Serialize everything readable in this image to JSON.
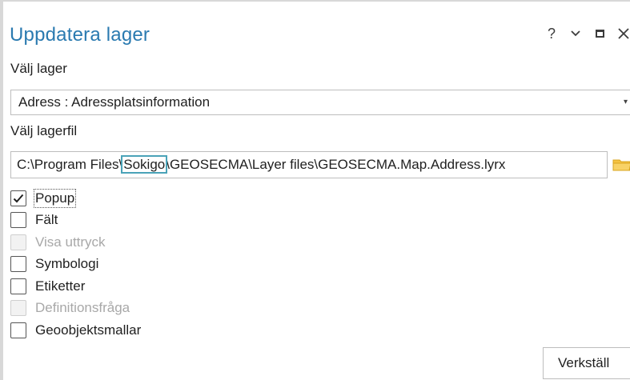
{
  "pane": {
    "title": "Uppdatera lager",
    "controls": {
      "help": "?",
      "menu": "⌄",
      "close": "✕"
    }
  },
  "layer_select": {
    "label": "Välj lager",
    "value": "Adress : Adressplatsinformation",
    "arrow": "▾"
  },
  "layer_file": {
    "label": "Välj lagerfil",
    "path_before": "C:\\Program Files\\",
    "path_highlight": "Sokigo",
    "path_after": "\\GEOSECMA\\Layer files\\GEOSECMA.Map.Address.lyrx"
  },
  "options": [
    {
      "label": "Popup",
      "checked": true,
      "enabled": true
    },
    {
      "label": "Fält",
      "checked": false,
      "enabled": true
    },
    {
      "label": "Visa uttryck",
      "checked": false,
      "enabled": false
    },
    {
      "label": "Symbologi",
      "checked": false,
      "enabled": true
    },
    {
      "label": "Etiketter",
      "checked": false,
      "enabled": true
    },
    {
      "label": "Definitionsfråga",
      "checked": false,
      "enabled": false
    },
    {
      "label": "Geoobjektsmallar",
      "checked": false,
      "enabled": true
    }
  ],
  "apply_button": {
    "label": "Verkställ"
  },
  "colors": {
    "title": "#2a7ab0",
    "highlight_outline": "#4aa3b8",
    "folder": "#f5c342"
  }
}
